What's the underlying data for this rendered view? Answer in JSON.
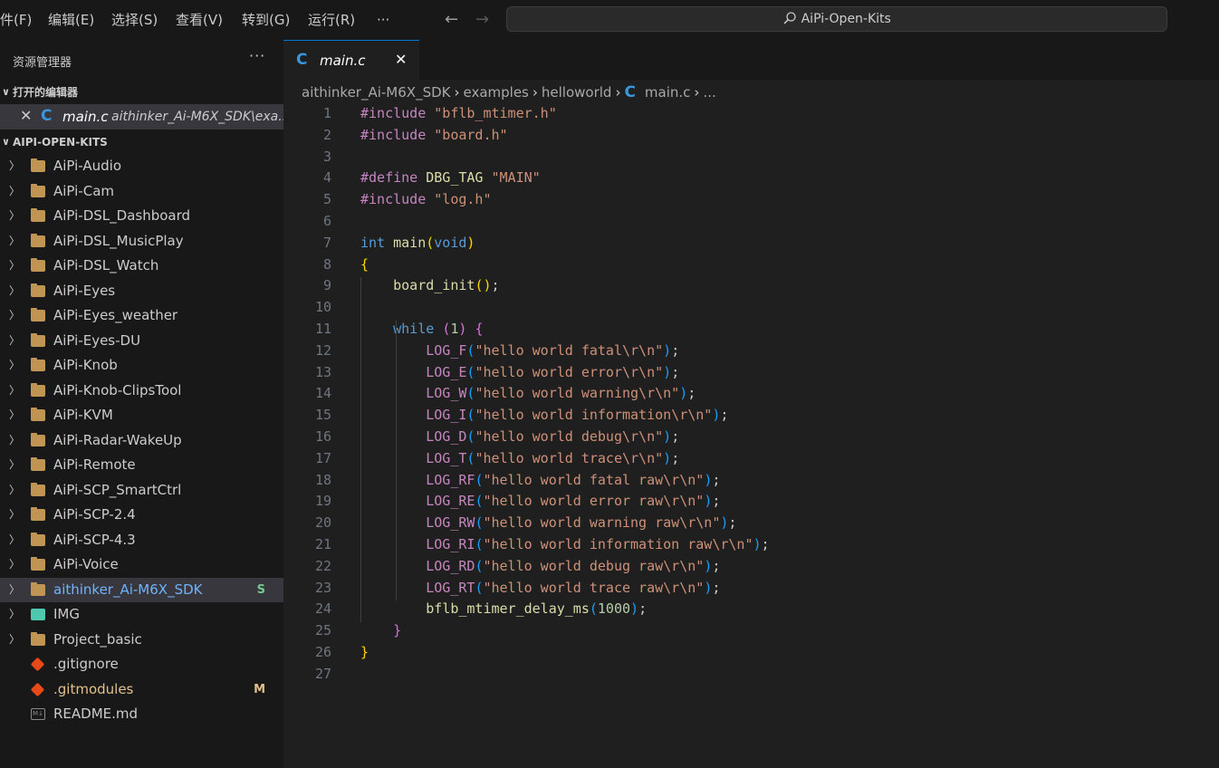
{
  "menubar": {
    "items": [
      "件(F)",
      "编辑(E)",
      "选择(S)",
      "查看(V)",
      "转到(G)",
      "运行(R)"
    ],
    "more": "···",
    "back_icon": "arrow-left-icon",
    "forward_icon": "arrow-right-icon"
  },
  "command_center": {
    "search_icon": "search-icon",
    "text": "AiPi-Open-Kits"
  },
  "sidebar": {
    "title": "资源管理器",
    "more": "···",
    "open_editors": {
      "header": "打开的编辑器",
      "item_name": "main.c",
      "item_path": "aithinker_Ai-M6X_SDK\\exa..."
    },
    "workspace": {
      "header": "AIPI-OPEN-KITS",
      "items": [
        {
          "name": "AiPi-Audio",
          "type": "folder"
        },
        {
          "name": "AiPi-Cam",
          "type": "folder"
        },
        {
          "name": "AiPi-DSL_Dashboard",
          "type": "folder"
        },
        {
          "name": "AiPi-DSL_MusicPlay",
          "type": "folder"
        },
        {
          "name": "AiPi-DSL_Watch",
          "type": "folder"
        },
        {
          "name": "AiPi-Eyes",
          "type": "folder"
        },
        {
          "name": "AiPi-Eyes_weather",
          "type": "folder"
        },
        {
          "name": "AiPi-Eyes-DU",
          "type": "folder"
        },
        {
          "name": "AiPi-Knob",
          "type": "folder"
        },
        {
          "name": "AiPi-Knob-ClipsTool",
          "type": "folder"
        },
        {
          "name": "AiPi-KVM",
          "type": "folder"
        },
        {
          "name": "AiPi-Radar-WakeUp",
          "type": "folder"
        },
        {
          "name": "AiPi-Remote",
          "type": "folder"
        },
        {
          "name": "AiPi-SCP_SmartCtrl",
          "type": "folder"
        },
        {
          "name": "AiPi-SCP-2.4",
          "type": "folder"
        },
        {
          "name": "AiPi-SCP-4.3",
          "type": "folder"
        },
        {
          "name": "AiPi-Voice",
          "type": "folder"
        },
        {
          "name": "aithinker_Ai-M6X_SDK",
          "type": "folder",
          "badge": "S",
          "selected": true
        },
        {
          "name": "IMG",
          "type": "image-folder"
        },
        {
          "name": "Project_basic",
          "type": "folder"
        },
        {
          "name": ".gitignore",
          "type": "git-file"
        },
        {
          "name": ".gitmodules",
          "type": "git-file",
          "badge": "M"
        },
        {
          "name": "README.md",
          "type": "markdown-file"
        }
      ]
    }
  },
  "editor": {
    "tab": {
      "label": "main.c",
      "close": "✕"
    },
    "breadcrumb": [
      "aithinker_Ai-M6X_SDK",
      "examples",
      "helloworld",
      "main.c",
      "..."
    ],
    "lines": [
      "#include \"bflb_mtimer.h\"",
      "#include \"board.h\"",
      "",
      "#define DBG_TAG \"MAIN\"",
      "#include \"log.h\"",
      "",
      "int main(void)",
      "{",
      "    board_init();",
      "",
      "    while (1) {",
      "        LOG_F(\"hello world fatal\\r\\n\");",
      "        LOG_E(\"hello world error\\r\\n\");",
      "        LOG_W(\"hello world warning\\r\\n\");",
      "        LOG_I(\"hello world information\\r\\n\");",
      "        LOG_D(\"hello world debug\\r\\n\");",
      "        LOG_T(\"hello world trace\\r\\n\");",
      "        LOG_RF(\"hello world fatal raw\\r\\n\");",
      "        LOG_RE(\"hello world error raw\\r\\n\");",
      "        LOG_RW(\"hello world warning raw\\r\\n\");",
      "        LOG_RI(\"hello world information raw\\r\\n\");",
      "        LOG_RD(\"hello world debug raw\\r\\n\");",
      "        LOG_RT(\"hello world trace raw\\r\\n\");",
      "        bflb_mtimer_delay_ms(1000);",
      "    }",
      "}",
      ""
    ]
  },
  "colors": {
    "accent": "#0078d4",
    "folder": "#c09553",
    "modified": "#e2c08d",
    "untracked": "#73c991",
    "keyword": "#569cd6",
    "string": "#ce9178",
    "function": "#dcdcaa",
    "macro": "#c586c0"
  }
}
